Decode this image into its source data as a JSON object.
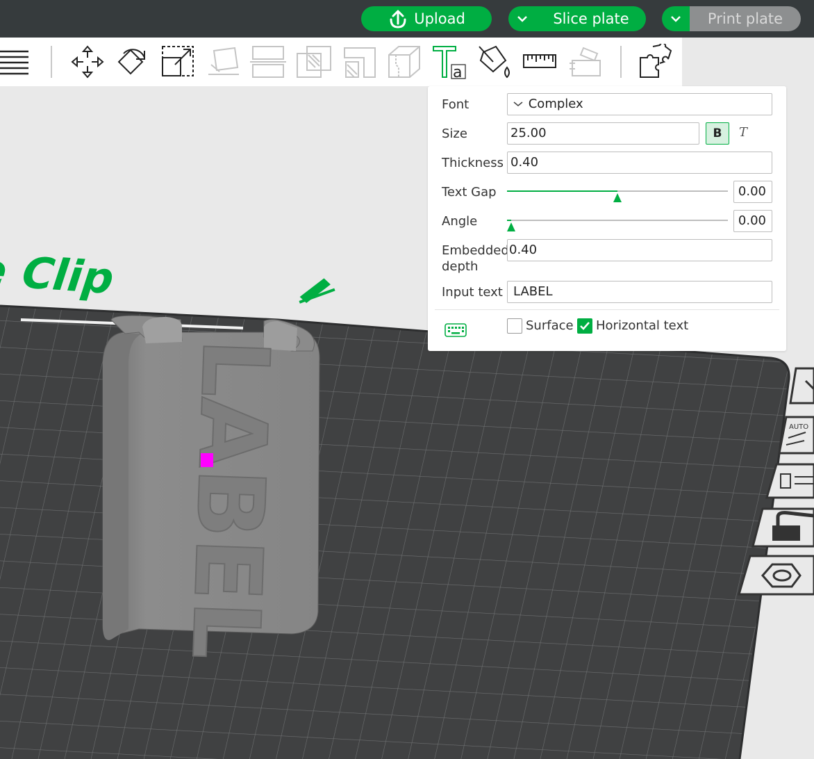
{
  "topbar": {
    "upload_label": "Upload",
    "slice_label": "Slice plate",
    "print_label": "Print plate"
  },
  "toolbar": {
    "icons": [
      "menu-icon",
      "move-icon",
      "rotate-icon",
      "scale-icon",
      "lay-on-face-icon",
      "cut-icon",
      "boolean-icon",
      "support-paint-icon",
      "seam-paint-icon",
      "text-icon",
      "color-paint-icon",
      "measure-icon",
      "assembly-icon",
      "variable-layer-icon"
    ]
  },
  "scene": {
    "plate_name": "ose Clip",
    "model_text": "LABEL",
    "side_auto_label": "AUTO"
  },
  "text_panel": {
    "font_label": "Font",
    "font_value": "Complex",
    "size_label": "Size",
    "size_value": "25.00",
    "bold_label": "B",
    "italic_label": "T",
    "thickness_label": "Thickness",
    "thickness_value": "0.40",
    "text_gap_label": "Text Gap",
    "text_gap_value": "0.00",
    "text_gap_slider": 0.5,
    "angle_label": "Angle",
    "angle_value": "0.00",
    "angle_slider": 0.02,
    "embedded_label_1": "Embedded",
    "embedded_label_2": "depth",
    "embedded_value": "0.40",
    "input_text_label": "Input text",
    "input_text_value": "LABEL",
    "surface_label": "Surface",
    "surface_checked": false,
    "horizontal_label": "Horizontal text",
    "horizontal_checked": true
  },
  "colors": {
    "accent": "#00ae42",
    "topbar": "#363b3d",
    "plate": "#3f4041",
    "model": "#8a8a8a"
  }
}
